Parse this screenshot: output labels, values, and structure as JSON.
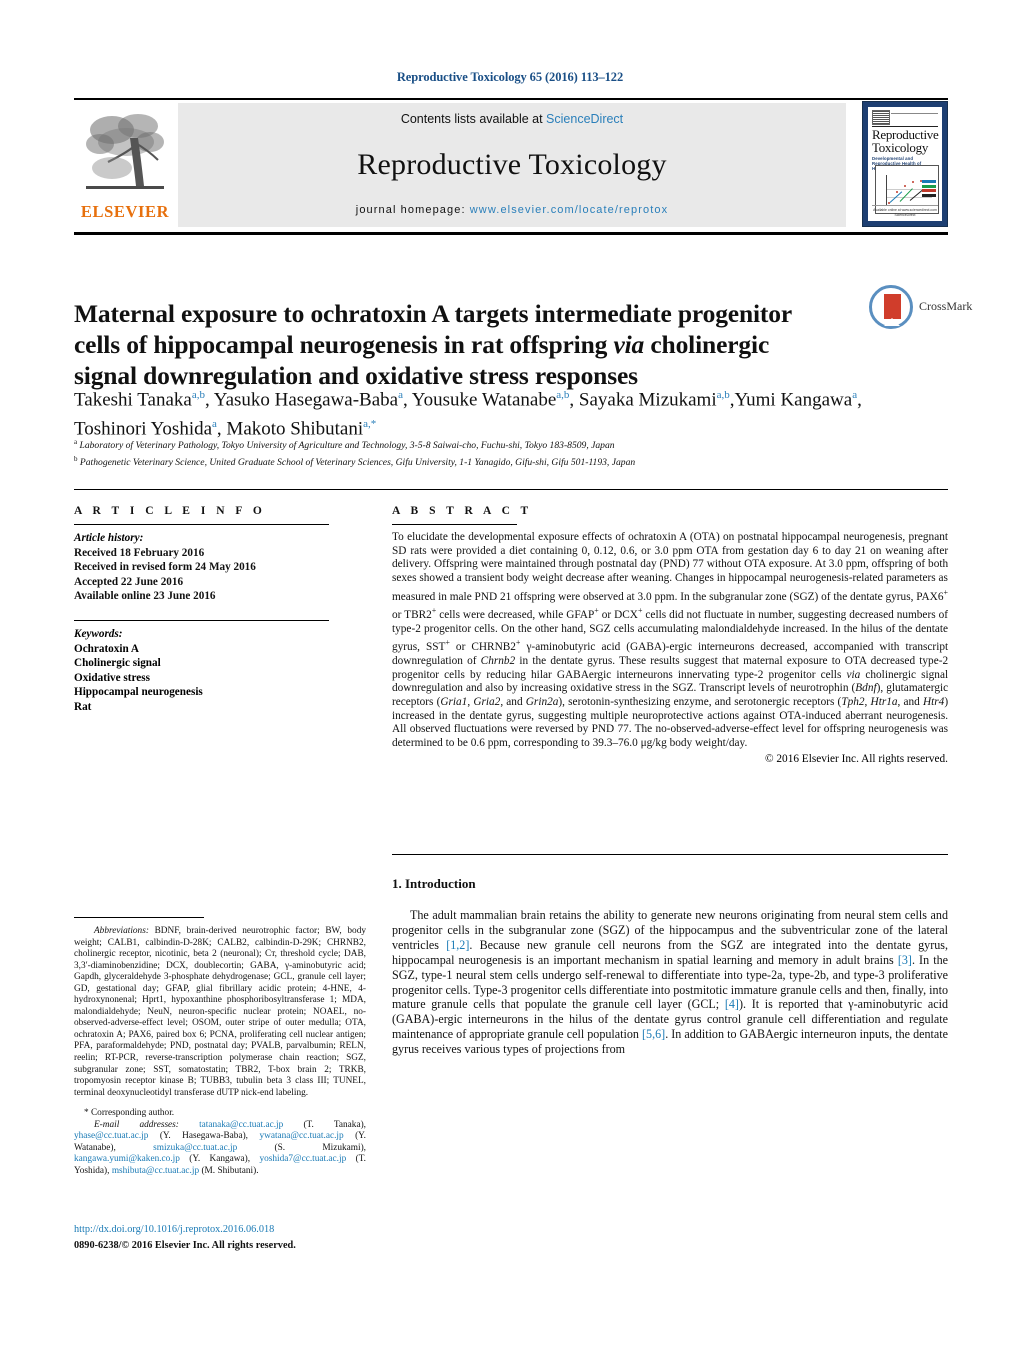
{
  "running_head": "Reproductive Toxicology 65 (2016) 113–122",
  "header": {
    "contents_prefix": "Contents lists available at ",
    "sciencedirect": "ScienceDirect",
    "journal_name": "Reproductive Toxicology",
    "homepage_label": "journal homepage: ",
    "homepage_url": "www.elsevier.com/locate/reprotox",
    "publisher": "ELSEVIER",
    "cover": {
      "line1": "Reproductive",
      "line2": "Toxicology",
      "subtitle": "Developmental and Reproductive Health of Humans",
      "footer": "Available online at www.sciencedirect.com  ScienceDirect"
    }
  },
  "article": {
    "title_line1": "Maternal exposure to ochratoxin A targets intermediate progenitor",
    "title_line2_a": "cells of hippocampal neurogenesis in rat offspring ",
    "title_line2_italic": "via",
    "title_line2_b": " cholinergic",
    "title_line3": "signal downregulation and oxidative stress responses",
    "crossmark_label": "CrossMark",
    "authors": [
      {
        "name": "Takeshi Tanaka",
        "sup": "a,b",
        "sep": ", "
      },
      {
        "name": "Yasuko Hasegawa-Baba",
        "sup": "a",
        "sep": ", "
      },
      {
        "name": "Yousuke Watanabe",
        "sup": "a,b",
        "sep": ", "
      },
      {
        "name": "Sayaka Mizukami",
        "sup": "a,b",
        "sep": ","
      },
      {
        "name": "Yumi Kangawa",
        "sup": "a",
        "sep": ", "
      },
      {
        "name": "Toshinori Yoshida",
        "sup": "a",
        "sep": ", "
      },
      {
        "name": "Makoto Shibutani",
        "sup": "a,*",
        "sep": ""
      }
    ],
    "affiliations": [
      {
        "marker": "a",
        "text": "Laboratory of Veterinary Pathology, Tokyo University of Agriculture and Technology, 3-5-8 Saiwai-cho, Fuchu-shi, Tokyo 183-8509, Japan"
      },
      {
        "marker": "b",
        "text": "Pathogenetic Veterinary Science, United Graduate School of Veterinary Sciences, Gifu University, 1-1 Yanagido, Gifu-shi, Gifu 501-1193, Japan"
      }
    ]
  },
  "article_info": {
    "heading": "A R T I C L E   I N F O",
    "history_label": "Article history:",
    "history": [
      "Received 18 February 2016",
      "Received in revised form 24 May 2016",
      "Accepted 22 June 2016",
      "Available online 23 June 2016"
    ],
    "keywords_label": "Keywords:",
    "keywords": [
      "Ochratoxin A",
      "Cholinergic signal",
      "Oxidative stress",
      "Hippocampal neurogenesis",
      "Rat"
    ]
  },
  "abstract": {
    "heading": "A B S T R A C T",
    "text": "To elucidate the developmental exposure effects of ochratoxin A (OTA) on postnatal hippocampal neurogenesis, pregnant SD rats were provided a diet containing 0, 0.12, 0.6, or 3.0 ppm OTA from gestation day 6 to day 21 on weaning after delivery. Offspring were maintained through postnatal day (PND) 77 without OTA exposure. At 3.0 ppm, offspring of both sexes showed a transient body weight decrease after weaning. Changes in hippocampal neurogenesis-related parameters as measured in male PND 21 offspring were observed at 3.0 ppm. In the subgranular zone (SGZ) of the dentate gyrus, PAX6+ or TBR2+ cells were decreased, while GFAP+ or DCX+ cells did not fluctuate in number, suggesting decreased numbers of type-2 progenitor cells. On the other hand, SGZ cells accumulating malondialdehyde increased. In the hilus of the dentate gyrus, SST+ or CHRNB2+ γ-aminobutyric acid (GABA)-ergic interneurons decreased, accompanied with transcript downregulation of Chrnb2 in the dentate gyrus. These results suggest that maternal exposure to OTA decreased type-2 progenitor cells by reducing hilar GABAergic interneurons innervating type-2 progenitor cells via cholinergic signal downregulation and also by increasing oxidative stress in the SGZ. Transcript levels of neurotrophin (Bdnf), glutamatergic receptors (Gria1, Gria2, and Grin2a), serotonin-synthesizing enzyme, and serotonergic receptors (Tph2, Htr1a, and Htr4) increased in the dentate gyrus, suggesting multiple neuroprotective actions against OTA-induced aberrant neurogenesis. All observed fluctuations were reversed by PND 77. The no-observed-adverse-effect level for offspring neurogenesis was determined to be 0.6 ppm, corresponding to 39.3–76.0 μg/kg body weight/day.",
    "copyright": "© 2016 Elsevier Inc. All rights reserved."
  },
  "introduction": {
    "heading": "1.  Introduction",
    "paragraph": "The adult mammalian brain retains the ability to generate new neurons originating from neural stem cells and progenitor cells in the subgranular zone (SGZ) of the hippocampus and the subventricular zone of the lateral ventricles [1,2]. Because new granule cell neurons from the SGZ are integrated into the dentate gyrus, hippocampal neurogenesis is an important mechanism in spatial learning and memory in adult brains [3]. In the SGZ, type-1 neural stem cells undergo self-renewal to differentiate into type-2a, type-2b, and type-3 proliferative progenitor cells. Type-3 progenitor cells differentiate into postmitotic immature granule cells and then, finally, into mature granule cells that populate the granule cell layer (GCL; [4]). It is reported that γ-aminobutyric acid (GABA)-ergic interneurons in the hilus of the dentate gyrus control granule cell differentiation and regulate maintenance of appropriate granule cell population [5,6]. In addition to GABAergic interneuron inputs, the dentate gyrus receives various types of projections from"
  },
  "footnotes": {
    "abbreviations_label": "Abbreviations:",
    "abbreviations_text": "BDNF, brain-derived neurotrophic factor; BW, body weight; CALB1, calbindin-D-28K; CALB2, calbindin-D-29K; CHRNB2, cholinergic receptor, nicotinic, beta 2 (neuronal); Cт, threshold cycle; DAB, 3,3′-diaminobenzidine; DCX, doublecortin; GABA, γ-aminobutyric acid; Gapdh, glyceraldehyde 3-phosphate dehydrogenase; GCL, granule cell layer; GD, gestational day; GFAP, glial fibrillary acidic protein; 4-HNE, 4-hydroxynonenal; Hprt1, hypoxanthine phosphoribosyltransferase 1; MDA, malondialdehyde; NeuN, neuron-specific nuclear protein; NOAEL, no-observed-adverse-effect level; OSOM, outer stripe of outer medulla; OTA, ochratoxin A; PAX6, paired box 6; PCNA, proliferating cell nuclear antigen; PFA, paraformaldehyde; PND, postnatal day; PVALB, parvalbumin; RELN, reelin; RT-PCR, reverse-transcription polymerase chain reaction; SGZ, subgranular zone; SST, somatostatin; TBR2, T-box brain 2; TRKB, tropomyosin receptor kinase B; TUBB3, tubulin beta 3 class III; TUNEL, terminal deoxynucleotidyl transferase dUTP nick-end labeling.",
    "corresponding_author": "* Corresponding author.",
    "email_label": "E-mail addresses:",
    "emails": [
      {
        "address": "tatanaka@cc.tuat.ac.jp",
        "person": "(T. Tanaka)"
      },
      {
        "address": "yhase@cc.tuat.ac.jp",
        "person": "(Y. Hasegawa-Baba)"
      },
      {
        "address": "ywatana@cc.tuat.ac.jp",
        "person": "(Y. Watanabe)"
      },
      {
        "address": "smizuka@cc.tuat.ac.jp",
        "person": "(S. Mizukami)"
      },
      {
        "address": "kangawa.yumi@kaken.co.jp",
        "person": "(Y. Kangawa)"
      },
      {
        "address": "yoshida7@cc.tuat.ac.jp",
        "person": "(T. Yoshida)"
      },
      {
        "address": "mshibuta@cc.tuat.ac.jp",
        "person": "(M. Shibutani)"
      }
    ],
    "doi": "http://dx.doi.org/10.1016/j.reprotox.2016.06.018",
    "issn_line": "0890-6238/© 2016 Elsevier Inc. All rights reserved."
  }
}
